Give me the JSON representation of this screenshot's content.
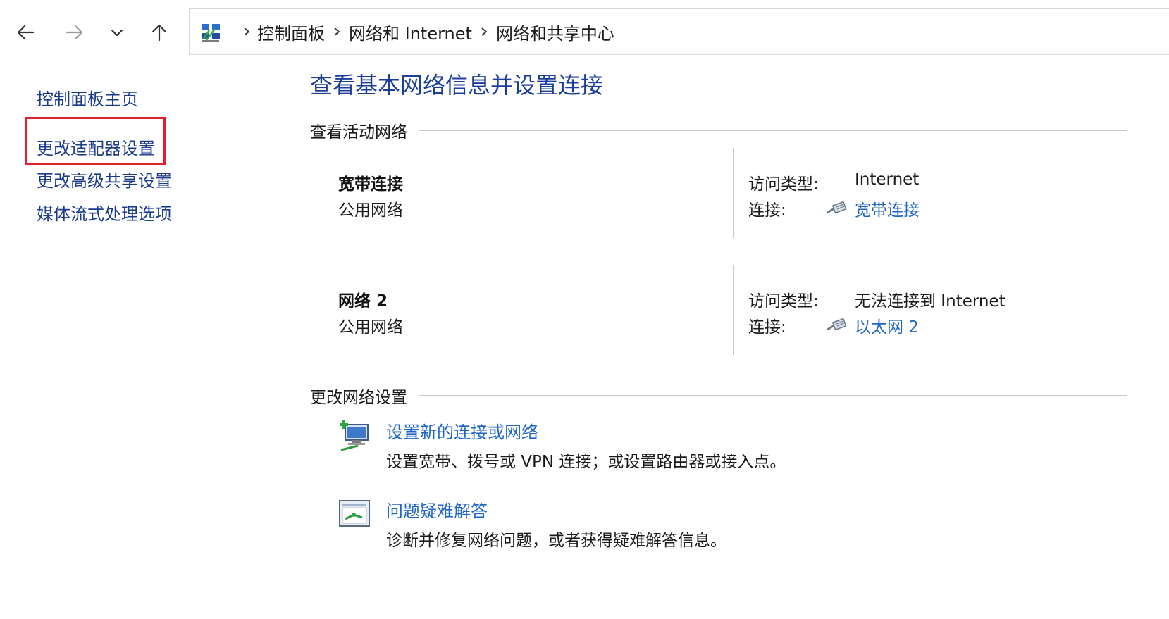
{
  "nav": {
    "back_icon": "arrow-left-icon",
    "forward_icon": "arrow-right-icon",
    "recent_icon": "chevron-down-icon",
    "up_icon": "arrow-up-icon"
  },
  "address": {
    "icon": "control-panel-icon",
    "crumbs": [
      "控制面板",
      "网络和 Internet",
      "网络和共享中心"
    ]
  },
  "sidebar": {
    "items": [
      {
        "label": "控制面板主页"
      },
      {
        "label": "更改适配器设置",
        "highlighted": true
      },
      {
        "label": "更改高级共享设置"
      },
      {
        "label": "媒体流式处理选项"
      }
    ],
    "highlight_color": "#e0202a"
  },
  "main": {
    "title": "查看基本网络信息并设置连接",
    "active_header": "查看活动网络",
    "networks": [
      {
        "name": "宽带连接",
        "type": "公用网络",
        "access_label": "访问类型:",
        "access_value": "Internet",
        "connection_label": "连接:",
        "connection_value": "宽带连接",
        "connection_icon": "network-cable-icon"
      },
      {
        "name": "网络 2",
        "type": "公用网络",
        "access_label": "访问类型:",
        "access_value": "无法连接到 Internet",
        "connection_label": "连接:",
        "connection_value": "以太网 2",
        "connection_icon": "network-cable-icon"
      }
    ],
    "change_header": "更改网络设置",
    "tasks": [
      {
        "icon": "new-connection-icon",
        "label": "设置新的连接或网络",
        "description": "设置宽带、拨号或 VPN 连接；或设置路由器或接入点。"
      },
      {
        "icon": "troubleshoot-icon",
        "label": "问题疑难解答",
        "description": "诊断并修复网络问题，或者获得疑难解答信息。"
      }
    ]
  },
  "colors": {
    "title_blue": "#1b3e9a",
    "link_blue": "#1f66c4",
    "sidebar_link": "#1a3a8a"
  }
}
